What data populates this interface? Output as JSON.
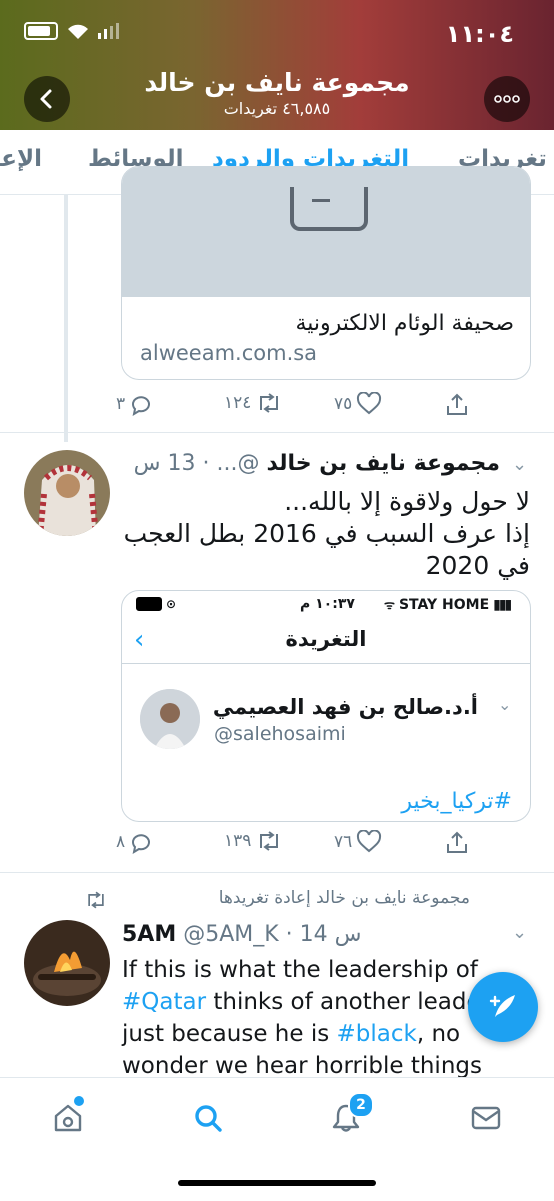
{
  "status_bar": {
    "time": "١١:٠٤"
  },
  "header": {
    "title": "مجموعة نايف بن خالد",
    "subtitle": "٤٦,٥٨٥ تغريدات"
  },
  "tabs": [
    {
      "label": "تغريدات"
    },
    {
      "label": "التغريدات والردود"
    },
    {
      "label": "الوسائط"
    },
    {
      "label": "الإعجابات"
    }
  ],
  "link_card": {
    "title": "صحيفة الوئام الالكترونية",
    "domain": "alweeam.com.sa"
  },
  "tweet1_actions": {
    "replies": "٣",
    "retweets": "١٢٤",
    "likes": "٧٥"
  },
  "tweet2": {
    "name": "مجموعة نايف بن خالد",
    "meta": "@... · 13 س",
    "text_line1": "لا حول  ولاقوة إلا بالله...",
    "text_line2": "إذا عرف السبب في 2016 بطل العجب",
    "text_line3": "في 2020",
    "quote": {
      "status_time": "١٠:٣٧ م",
      "status_carrier": "STAY HOME",
      "header_title": "التغريدة",
      "name": "أ.د.صالح بن فهد العصيمي",
      "handle": "@salehosaimi",
      "hashtag": "#تركيا_بخير"
    },
    "actions": {
      "replies": "٨",
      "retweets": "١٣٩",
      "likes": "٧٦"
    }
  },
  "tweet3": {
    "retweet_label": "مجموعة نايف بن خالد إعادة تغريدها",
    "name": "5AM",
    "meta": "@5AM_K · 14 س",
    "text_part1": "If this is what the leadership of ",
    "hashtag1": "#Qatar",
    "text_part2": " thinks of another leader just because he is ",
    "hashtag2": "#black",
    "text_part3": ", no wonder we hear horrible things"
  },
  "bottom_nav": {
    "notifications_badge": "2"
  },
  "colors": {
    "accent": "#1da1f2",
    "secondary_text": "#657786",
    "border": "#e1e8ed"
  },
  "icons": [
    "back-arrow-icon",
    "more-icon",
    "reply-icon",
    "retweet-icon",
    "like-icon",
    "share-icon",
    "compose-icon",
    "home-icon",
    "search-icon",
    "notifications-icon",
    "messages-icon"
  ]
}
